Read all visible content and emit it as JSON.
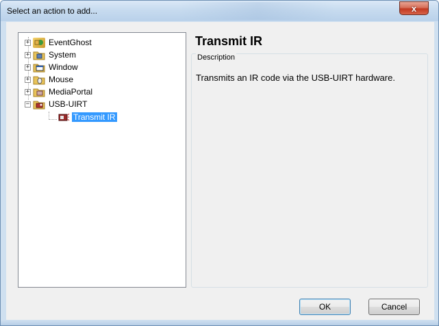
{
  "window": {
    "title": "Select an action to add...",
    "close_glyph": "x"
  },
  "tree": {
    "items": [
      {
        "label": "EventGhost",
        "icon": "eventghost-plugin-icon",
        "expander": "+"
      },
      {
        "label": "System",
        "icon": "system-folder-icon",
        "expander": "+"
      },
      {
        "label": "Window",
        "icon": "window-folder-icon",
        "expander": "+"
      },
      {
        "label": "Mouse",
        "icon": "mouse-folder-icon",
        "expander": "+"
      },
      {
        "label": "MediaPortal",
        "icon": "mediaportal-folder-icon",
        "expander": "+"
      },
      {
        "label": "USB-UIRT",
        "icon": "usb-uirt-folder-icon",
        "expander": "−"
      }
    ],
    "selected_child": {
      "label": "Transmit IR",
      "icon": "transmit-ir-icon"
    }
  },
  "detail": {
    "title": "Transmit IR",
    "group_label": "Description",
    "description": "Transmits an IR code via the USB-UIRT hardware."
  },
  "buttons": {
    "ok": "OK",
    "cancel": "Cancel"
  },
  "colors": {
    "selection": "#3399ff",
    "dialog_bg": "#f0f0f0",
    "close_button": "#c23a21"
  }
}
